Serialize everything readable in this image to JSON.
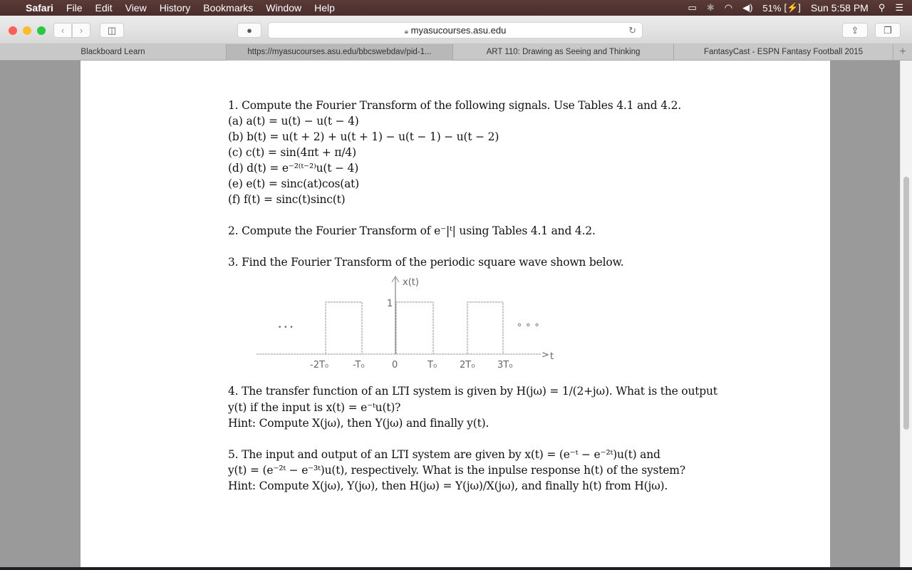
{
  "menubar": {
    "app": "Safari",
    "items": [
      "File",
      "Edit",
      "View",
      "History",
      "Bookmarks",
      "Window",
      "Help"
    ],
    "battery": "51%",
    "clock": "Sun 5:58 PM"
  },
  "toolbar": {
    "url": "myasucourses.asu.edu"
  },
  "tabs": [
    {
      "label": "Blackboard Learn",
      "active": false
    },
    {
      "label": "https://myasucourses.asu.edu/bbcswebdav/pid-1...",
      "active": true
    },
    {
      "label": "ART 110: Drawing as Seeing and Thinking",
      "active": false
    },
    {
      "label": "FantasyCast - ESPN Fantasy Football 2015",
      "active": false
    }
  ],
  "doc": {
    "q1": "1. Compute the Fourier Transform of the following signals. Use Tables 4.1 and 4.2.",
    "q1_parts": [
      "(a) a(t) = u(t) − u(t − 4)",
      "(b) b(t) = u(t + 2) + u(t + 1) − u(t − 1) − u(t − 2)",
      "(c) c(t) = sin(4πt + π/4)",
      "(d) d(t) = e⁻²⁽ᵗ⁻²⁾u(t − 4)",
      "(e) e(t) = sinc(at)cos(at)",
      "(f) f(t) = sinc(t)sinc(t)"
    ],
    "q2": "2. Compute the Fourier Transform of e⁻|ᵗ| using Tables 4.1 and 4.2.",
    "q3": "3. Find the Fourier Transform of the periodic square wave shown below.",
    "figure": {
      "ylabel": "x(t)",
      "amplitude": "1",
      "xlabel": "t",
      "ticks": [
        "-2T₀",
        "-T₀",
        "0",
        "T₀",
        "2T₀",
        "3T₀"
      ],
      "ellipsis_left": "• • •",
      "ellipsis_right": "∘ ∘ ∘"
    },
    "q4": [
      "4. The transfer function of an LTI system is given by H(jω) = 1/(2+jω). What is the output",
      "y(t) if the input is x(t) = e⁻ᵗu(t)?",
      "Hint: Compute X(jω), then Y(jω) and finally y(t)."
    ],
    "q5": [
      "5.  The input and output of an LTI system are given by x(t) = (e⁻ᵗ − e⁻²ᵗ)u(t) and",
      "y(t) = (e⁻²ᵗ − e⁻³ᵗ)u(t), respectively. What is the inpulse response h(t) of the system?",
      "Hint: Compute X(jω), Y(jω), then H(jω) = Y(jω)/X(jω), and finally h(t) from H(jω)."
    ]
  }
}
